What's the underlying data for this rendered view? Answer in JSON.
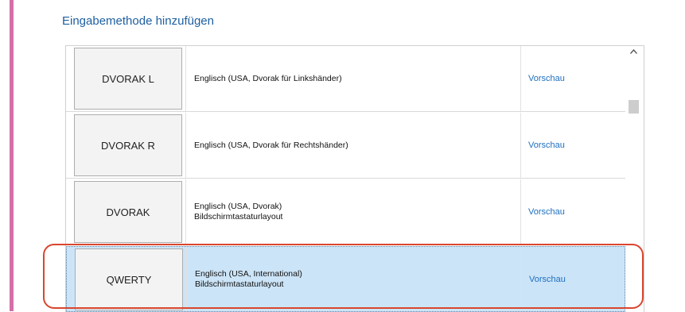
{
  "title": "Eingabemethode hinzufügen",
  "colors": {
    "accent": "#d46fa8",
    "link": "#1e6fc0",
    "selected": "#cce4f7",
    "highlight": "#d9462f"
  },
  "icons": {
    "scroll_up": "chevron-up-icon"
  },
  "rows": [
    {
      "key": "DVORAK L",
      "line1": "Englisch (USA, Dvorak für Linkshänder)",
      "line2": "",
      "preview": "Vorschau"
    },
    {
      "key": "DVORAK R",
      "line1": "Englisch (USA, Dvorak für Rechtshänder)",
      "line2": "",
      "preview": "Vorschau"
    },
    {
      "key": "DVORAK",
      "line1": "Englisch (USA, Dvorak)",
      "line2": "Bildschirmtastaturlayout",
      "preview": "Vorschau"
    },
    {
      "key": "QWERTY",
      "line1": "Englisch (USA, International)",
      "line2": "Bildschirmtastaturlayout",
      "preview": "Vorschau",
      "selected": true
    }
  ]
}
